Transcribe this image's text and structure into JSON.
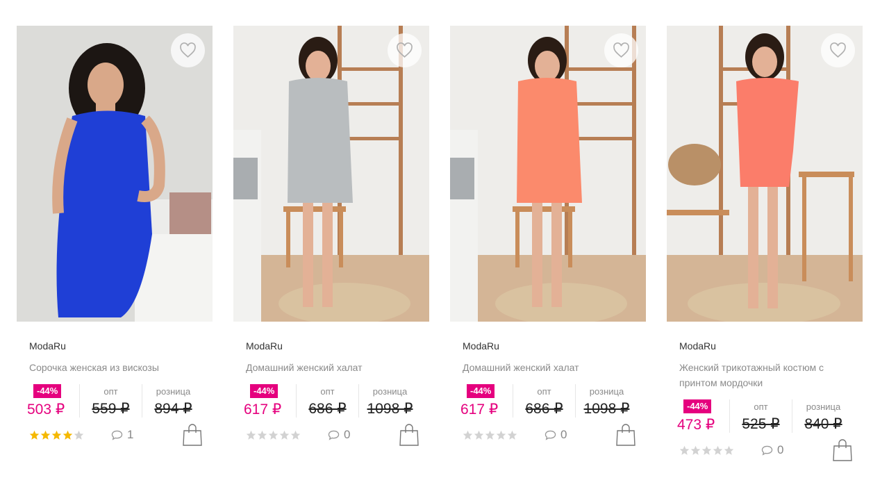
{
  "products": [
    {
      "brand": "ModaRu",
      "title": "Сорочка женская из вискозы",
      "discount": "-44%",
      "sale_price": "503 ₽",
      "opt_label": "опт",
      "opt_price": "559 ₽",
      "retail_label": "розница",
      "retail_price": "894 ₽",
      "rating": 4,
      "reviews": "1",
      "garment_color": "#1f3fd6"
    },
    {
      "brand": "ModaRu",
      "title": "Домашний женский халат",
      "discount": "-44%",
      "sale_price": "617 ₽",
      "opt_label": "опт",
      "opt_price": "686 ₽",
      "retail_label": "розница",
      "retail_price": "1098 ₽",
      "rating": 0,
      "reviews": "0",
      "garment_color": "#b9bdbf"
    },
    {
      "brand": "ModaRu",
      "title": "Домашний женский халат",
      "discount": "-44%",
      "sale_price": "617 ₽",
      "opt_label": "опт",
      "opt_price": "686 ₽",
      "retail_label": "розница",
      "retail_price": "1098 ₽",
      "rating": 0,
      "reviews": "0",
      "garment_color": "#fb8a6c"
    },
    {
      "brand": "ModaRu",
      "title": "Женский трикотажный костюм с принтом мордочки",
      "discount": "-44%",
      "sale_price": "473 ₽",
      "opt_label": "опт",
      "opt_price": "525 ₽",
      "retail_label": "розница",
      "retail_price": "840 ₽",
      "rating": 0,
      "reviews": "0",
      "garment_color": "#fb7d6a"
    }
  ],
  "colors": {
    "accent": "#e5007e",
    "star_filled": "#f5b800",
    "star_empty": "#d2d2d2"
  },
  "icons": {
    "favorite": "heart-icon",
    "reviews": "comment-icon",
    "cart": "shopping-bag-icon",
    "rating": "star-icon"
  }
}
